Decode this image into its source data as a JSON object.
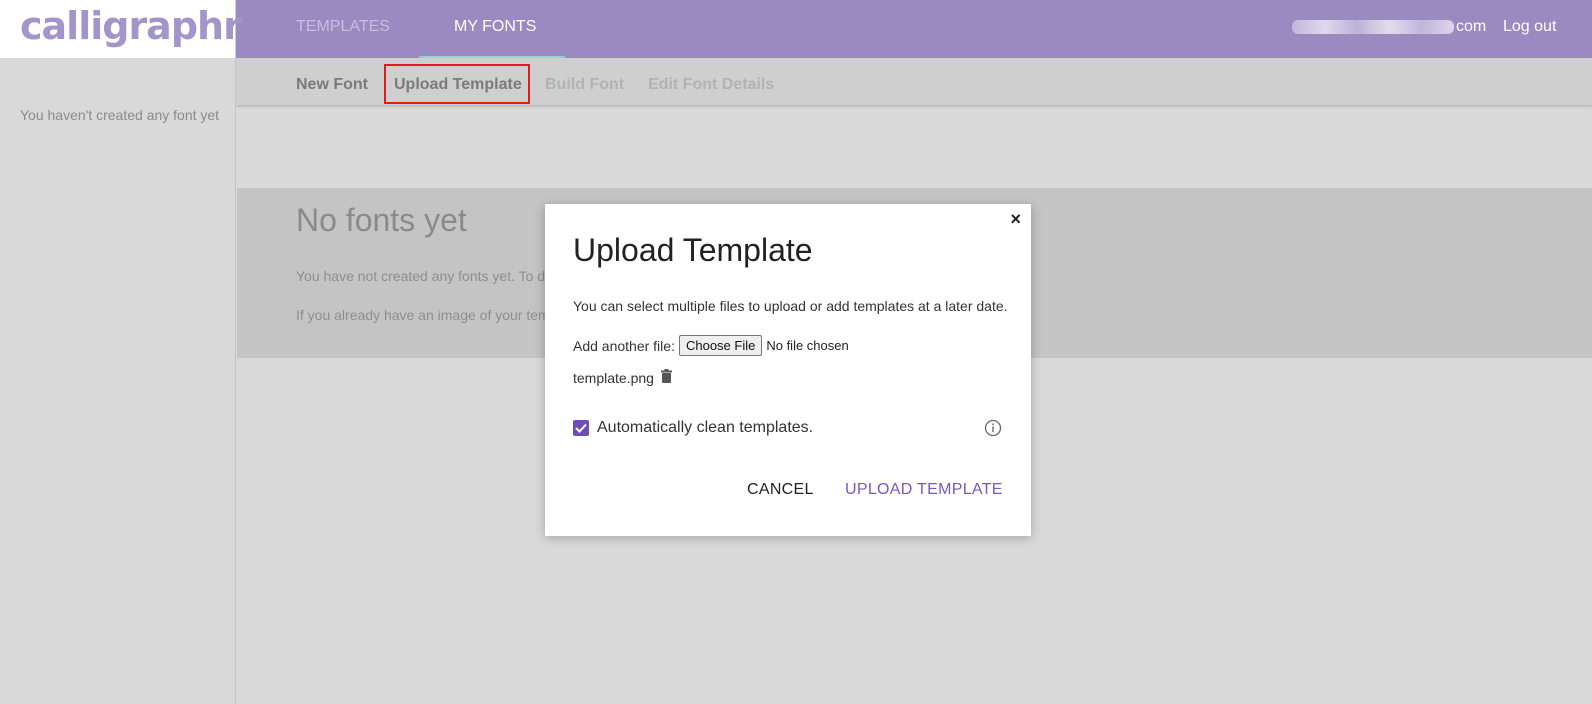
{
  "header": {
    "logo_text": "calligraphr",
    "tabs": [
      {
        "label": "TEMPLATES"
      },
      {
        "label": "MY FONTS"
      }
    ],
    "email_suffix": "com",
    "logout_label": "Log out"
  },
  "sidebar": {
    "empty_message": "You haven't created any font yet"
  },
  "subnav": {
    "items": [
      {
        "label": "New Font",
        "state": "enabled"
      },
      {
        "label": "Upload Template",
        "state": "enabled"
      },
      {
        "label": "Build Font",
        "state": "disabled"
      },
      {
        "label": "Edit Font Details",
        "state": "disabled"
      }
    ]
  },
  "main": {
    "title": "No fonts yet",
    "line1": "You have not created any fonts yet. To do",
    "line2": "If you already have an image of your temp"
  },
  "modal": {
    "close_symbol": "×",
    "title": "Upload Template",
    "description": "You can select multiple files to upload or add templates at a later date.",
    "file_label": "Add another file:",
    "choose_file_label": "Choose File",
    "no_file_text": "No file chosen",
    "attached_file": "template.png",
    "auto_clean_label": "Automatically clean templates.",
    "auto_clean_checked": true,
    "cancel_label": "CANCEL",
    "upload_label": "UPLOAD TEMPLATE"
  },
  "colors": {
    "header_bg": "#9b89c1",
    "accent_purple": "#7b55c7",
    "checkbox_purple": "#6f4cb9",
    "highlight_red": "#e21b1b",
    "tab_underline": "#8fd3cf"
  }
}
